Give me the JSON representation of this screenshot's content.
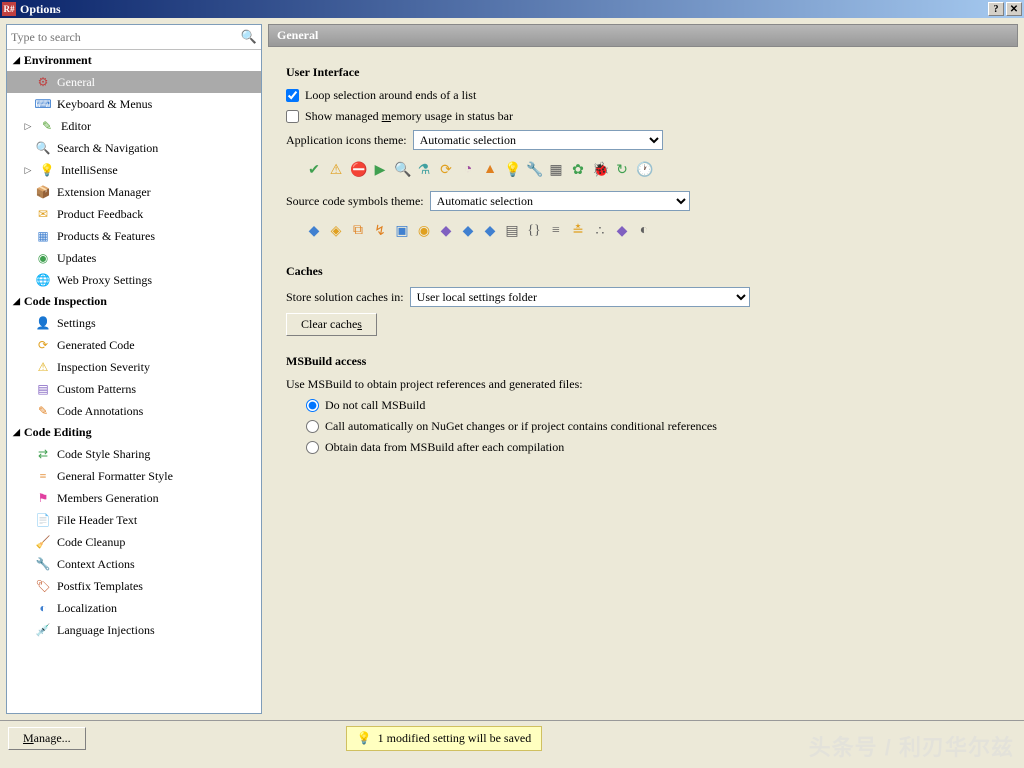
{
  "window": {
    "title": "Options"
  },
  "search": {
    "placeholder": "Type to search"
  },
  "sidebar": {
    "categories": [
      {
        "label": "Environment",
        "items": [
          {
            "label": "General",
            "selected": true,
            "icon": "⚙",
            "color": "#c04040"
          },
          {
            "label": "Keyboard & Menus",
            "icon": "⌨",
            "color": "#4080d0"
          },
          {
            "label": "Editor",
            "icon": "✎",
            "color": "#50a030",
            "expandable": true
          },
          {
            "label": "Search & Navigation",
            "icon": "🔍",
            "color": "#4080d0"
          },
          {
            "label": "IntelliSense",
            "icon": "💡",
            "color": "#e0b020",
            "expandable": true
          },
          {
            "label": "Extension Manager",
            "icon": "📦",
            "color": "#c05020"
          },
          {
            "label": "Product Feedback",
            "icon": "✉",
            "color": "#e0a020"
          },
          {
            "label": "Products & Features",
            "icon": "▦",
            "color": "#4080d0"
          },
          {
            "label": "Updates",
            "icon": "◉",
            "color": "#40a050"
          },
          {
            "label": "Web Proxy Settings",
            "icon": "🌐",
            "color": "#40a050"
          }
        ]
      },
      {
        "label": "Code Inspection",
        "items": [
          {
            "label": "Settings",
            "icon": "👤",
            "color": "#4080d0"
          },
          {
            "label": "Generated Code",
            "icon": "⟳",
            "color": "#e0a020"
          },
          {
            "label": "Inspection Severity",
            "icon": "⚠",
            "color": "#e0b020"
          },
          {
            "label": "Custom Patterns",
            "icon": "▤",
            "color": "#8060c0"
          },
          {
            "label": "Code Annotations",
            "icon": "✎",
            "color": "#e08020"
          }
        ]
      },
      {
        "label": "Code Editing",
        "items": [
          {
            "label": "Code Style Sharing",
            "icon": "⇄",
            "color": "#40a050"
          },
          {
            "label": "General Formatter Style",
            "icon": "≡",
            "color": "#e08020"
          },
          {
            "label": "Members Generation",
            "icon": "⚑",
            "color": "#e040a0"
          },
          {
            "label": "File Header Text",
            "icon": "📄",
            "color": "#40a050"
          },
          {
            "label": "Code Cleanup",
            "icon": "🧹",
            "color": "#e0a020"
          },
          {
            "label": "Context Actions",
            "icon": "🔧",
            "color": "#808080"
          },
          {
            "label": "Postfix Templates",
            "icon": "🏷",
            "color": "#c05020"
          },
          {
            "label": "Localization",
            "icon": "◐",
            "color": "#4080d0"
          },
          {
            "label": "Language Injections",
            "icon": "💉",
            "color": "#4080d0"
          }
        ]
      }
    ]
  },
  "main": {
    "title": "General",
    "ui": {
      "heading": "User Interface",
      "loop_label": "Loop selection around ends of a list",
      "loop_checked": true,
      "mem_label_pre": "Show managed ",
      "mem_label_u": "m",
      "mem_label_post": "emory usage in status bar",
      "mem_checked": false,
      "icons_label": "Application icons theme:",
      "icons_value": "Automatic selection",
      "symbols_label": "Source code symbols theme:",
      "symbols_value": "Automatic selection"
    },
    "caches": {
      "heading": "Caches",
      "store_label": "Store solution caches in:",
      "store_value": "User local settings folder",
      "clear_label_pre": "Clear cache",
      "clear_label_u": "s"
    },
    "msbuild": {
      "heading": "MSBuild access",
      "desc": "Use MSBuild to obtain project references and generated files:",
      "opt1": "Do not call MSBuild",
      "opt2": "Call automatically on NuGet changes or if project contains conditional references",
      "opt3": "Obtain data from MSBuild after each compilation",
      "selected": 0
    }
  },
  "footer": {
    "manage_label": "Manage...",
    "status_msg": "1  modified setting will be saved"
  },
  "watermark": "头条号 / 利刃华尔兹"
}
